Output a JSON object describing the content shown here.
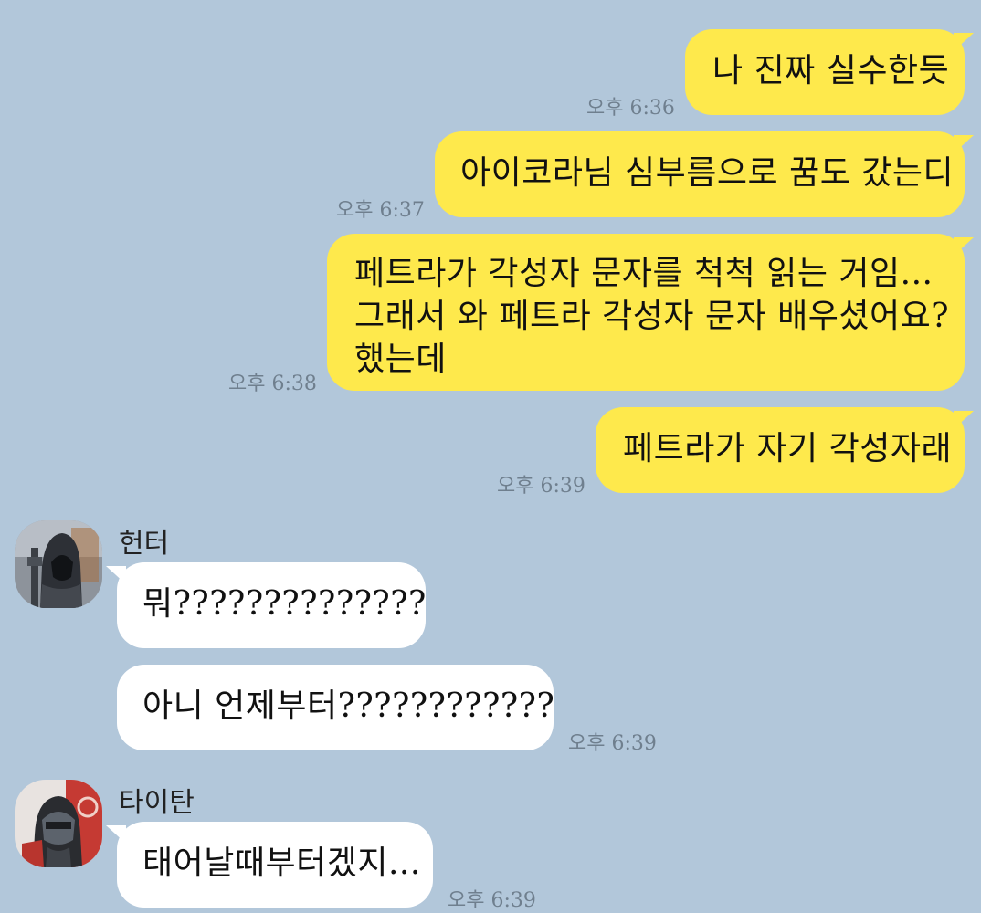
{
  "messages_out": [
    {
      "text": "나 진짜 실수한듯",
      "time": "오후 6:36"
    },
    {
      "text": "아이코라님 심부름으로 꿈도 갔는디",
      "time": "오후 6:37"
    },
    {
      "lines": [
        "페트라가 각성자 문자를 척척 읽는 거임...",
        "그래서 와 페트라 각성자 문자 배우셨어요?",
        "했는데"
      ],
      "time": "오후 6:38"
    },
    {
      "text": "페트라가 자기 각성자래",
      "time": "오후 6:39"
    }
  ],
  "sender_hunter": {
    "name": "헌터",
    "avatar_icon": "hooded-hunter-avatar",
    "messages": [
      {
        "text": "뭐??????????????"
      },
      {
        "text": "아니 언제부터????????????",
        "time": "오후 6:39"
      }
    ]
  },
  "sender_titan": {
    "name": "타이탄",
    "avatar_icon": "armored-titan-avatar",
    "messages": [
      {
        "text": "태어날때부터겠지...",
        "time": "오후 6:39"
      }
    ]
  },
  "colors": {
    "background": "#b2c7da",
    "outgoing_bubble": "#fee94c",
    "incoming_bubble": "#ffffff",
    "timestamp": "#6f7f8e"
  }
}
